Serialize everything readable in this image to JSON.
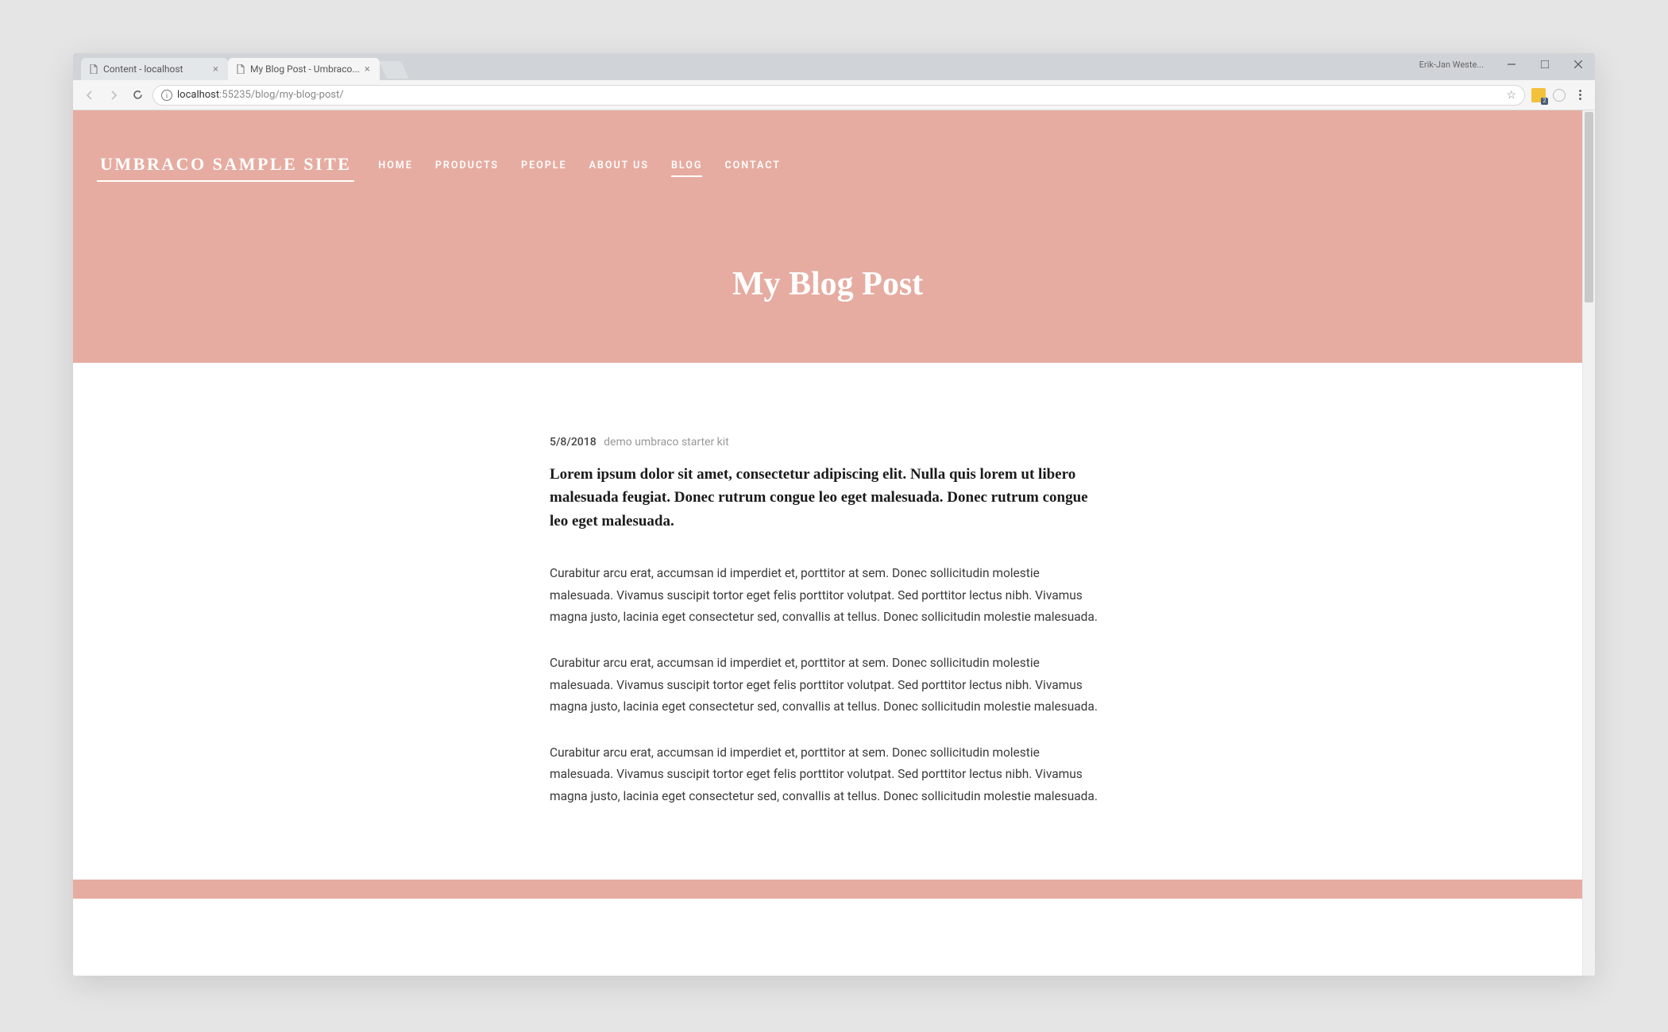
{
  "browser": {
    "tabs": [
      {
        "title": "Content - localhost",
        "active": false
      },
      {
        "title": "My Blog Post - Umbraco...",
        "active": true
      }
    ],
    "user_label": "Erik-Jan Weste...",
    "url_host": "localhost",
    "url_port": ":55235",
    "url_path": "/blog/my-blog-post/"
  },
  "site": {
    "logo": "UMBRACO SAMPLE SITE",
    "nav": [
      {
        "label": "HOME",
        "active": false
      },
      {
        "label": "PRODUCTS",
        "active": false
      },
      {
        "label": "PEOPLE",
        "active": false
      },
      {
        "label": "ABOUT US",
        "active": false
      },
      {
        "label": "BLOG",
        "active": true
      },
      {
        "label": "CONTACT",
        "active": false
      }
    ],
    "page_title": "My Blog Post"
  },
  "post": {
    "date": "5/8/2018",
    "author": "demo umbraco starter kit",
    "excerpt": "Lorem ipsum dolor sit amet, consectetur adipiscing elit. Nulla quis lorem ut libero malesuada feugiat. Donec rutrum congue leo eget malesuada. Donec rutrum congue leo eget malesuada.",
    "paragraphs": [
      "Curabitur arcu erat, accumsan id imperdiet et, porttitor at sem. Donec sollicitudin molestie malesuada. Vivamus suscipit tortor eget felis porttitor volutpat. Sed porttitor lectus nibh. Vivamus magna justo, lacinia eget consectetur sed, convallis at tellus. Donec sollicitudin molestie malesuada.",
      "Curabitur arcu erat, accumsan id imperdiet et, porttitor at sem. Donec sollicitudin molestie malesuada. Vivamus suscipit tortor eget felis porttitor volutpat. Sed porttitor lectus nibh. Vivamus magna justo, lacinia eget consectetur sed, convallis at tellus. Donec sollicitudin molestie malesuada.",
      "Curabitur arcu erat, accumsan id imperdiet et, porttitor at sem. Donec sollicitudin molestie malesuada. Vivamus suscipit tortor eget felis porttitor volutpat. Sed porttitor lectus nibh. Vivamus magna justo, lacinia eget consectetur sed, convallis at tellus. Donec sollicitudin molestie malesuada."
    ]
  }
}
